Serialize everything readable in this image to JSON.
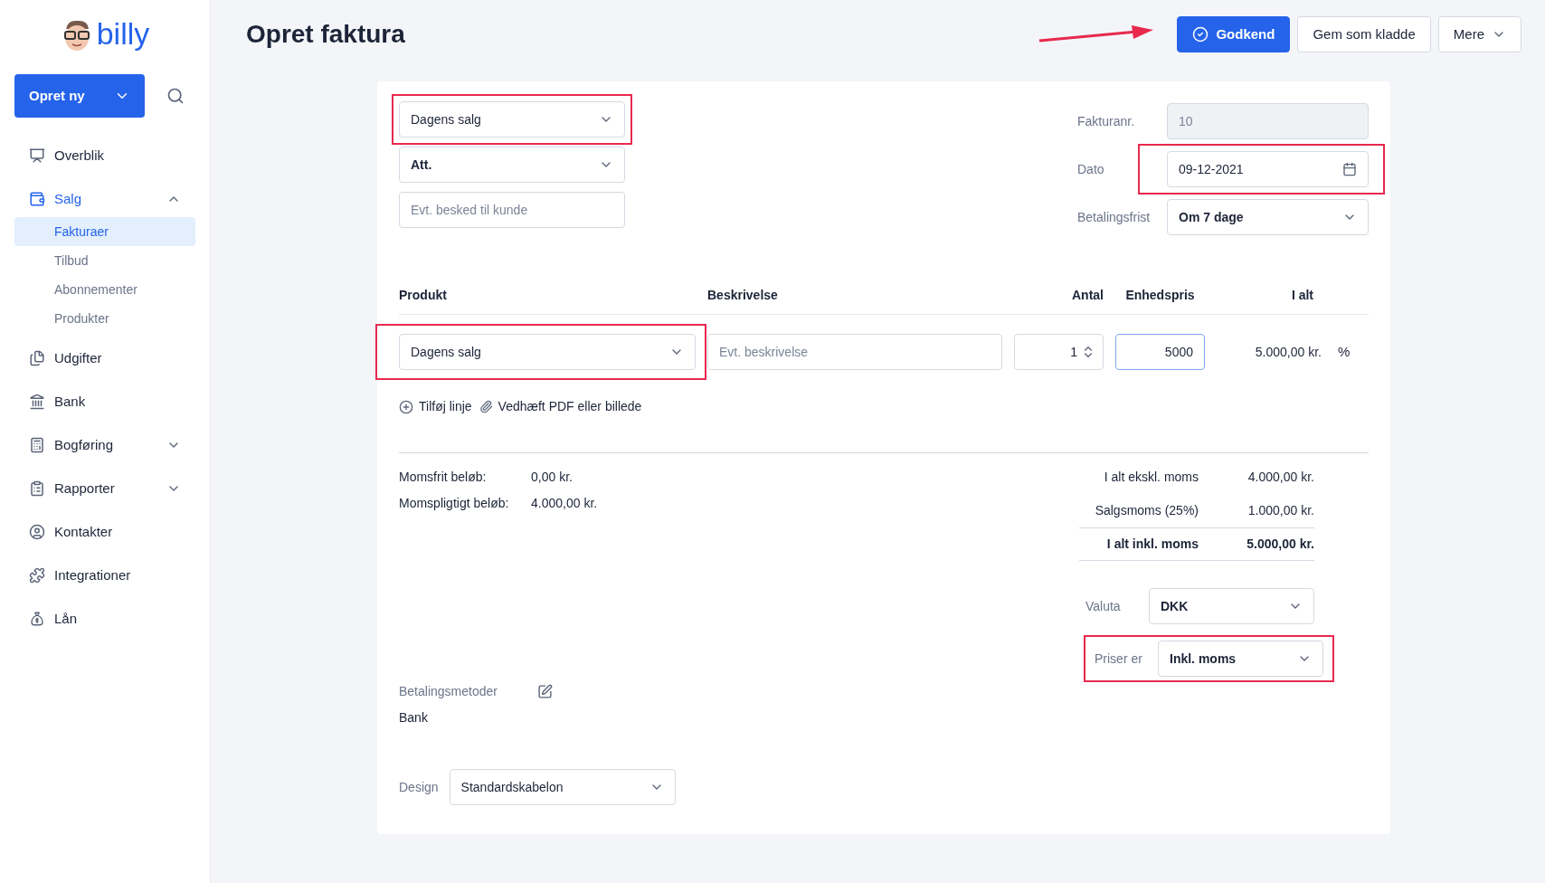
{
  "logo": {
    "text": "billy"
  },
  "sidebar": {
    "create_button": "Opret ny",
    "items": [
      {
        "label": "Overblik",
        "selected": false
      },
      {
        "label": "Salg",
        "selected": true,
        "expanded": true,
        "children": [
          {
            "label": "Fakturaer",
            "selected": true
          },
          {
            "label": "Tilbud",
            "selected": false
          },
          {
            "label": "Abonnementer",
            "selected": false
          },
          {
            "label": "Produkter",
            "selected": false
          }
        ]
      },
      {
        "label": "Udgifter",
        "selected": false
      },
      {
        "label": "Bank",
        "selected": false
      },
      {
        "label": "Bogføring",
        "selected": false,
        "expanded": false
      },
      {
        "label": "Rapporter",
        "selected": false,
        "expanded": false
      },
      {
        "label": "Kontakter",
        "selected": false
      },
      {
        "label": "Integrationer",
        "selected": false
      },
      {
        "label": "Lån",
        "selected": false
      }
    ]
  },
  "header": {
    "title": "Opret faktura",
    "buttons": [
      {
        "label": "Godkend",
        "kind": "primary"
      },
      {
        "label": "Gem som kladde",
        "kind": "secondary"
      },
      {
        "label": "Mere",
        "kind": "menu"
      }
    ]
  },
  "invoice": {
    "customer": {
      "value": "Dagens salg",
      "highlighted": true
    },
    "attention": {
      "value": "Att."
    },
    "message": {
      "placeholder": "Evt. besked til kunde"
    },
    "fields": [
      {
        "label": "Fakturanr.",
        "value": "10",
        "kind": "readonly"
      },
      {
        "label": "Dato",
        "value": "09-12-2021",
        "kind": "date",
        "highlighted": true
      },
      {
        "label": "Betalingsfrist",
        "value": "Om 7 dage",
        "kind": "select"
      }
    ],
    "columns": [
      "Produkt",
      "Beskrivelse",
      "Antal",
      "Enhedspris",
      "I alt"
    ],
    "lines": [
      {
        "product": "Dagens salg",
        "highlighted": true,
        "description_placeholder": "Evt. beskrivelse",
        "quantity": "1",
        "unit_price": "5000",
        "total": "5.000,00 kr.",
        "discount": "%"
      }
    ],
    "actions": [
      {
        "label": "Tilføj linje"
      },
      {
        "label": "Vedhæft PDF eller billede"
      }
    ],
    "vat_summary": [
      {
        "label": "Momsfrit beløb:",
        "value": "0,00 kr."
      },
      {
        "label": "Momspligtigt beløb:",
        "value": "4.000,00 kr."
      }
    ],
    "totals": [
      {
        "label": "I alt ekskl. moms",
        "value": "4.000,00 kr.",
        "kind": "subtotal"
      },
      {
        "label": "Salgsmoms (25%)",
        "value": "1.000,00 kr.",
        "kind": "tax"
      },
      {
        "label": "I alt inkl. moms",
        "value": "5.000,00 kr.",
        "kind": "total"
      }
    ],
    "currency": {
      "label": "Valuta",
      "value": "DKK"
    },
    "prices": {
      "label": "Priser er",
      "value": "Inkl. moms",
      "highlighted": true
    },
    "payment": {
      "label": "Betalingsmetoder",
      "value": "Bank"
    },
    "design": {
      "label": "Design",
      "value": "Standardskabelon"
    }
  }
}
